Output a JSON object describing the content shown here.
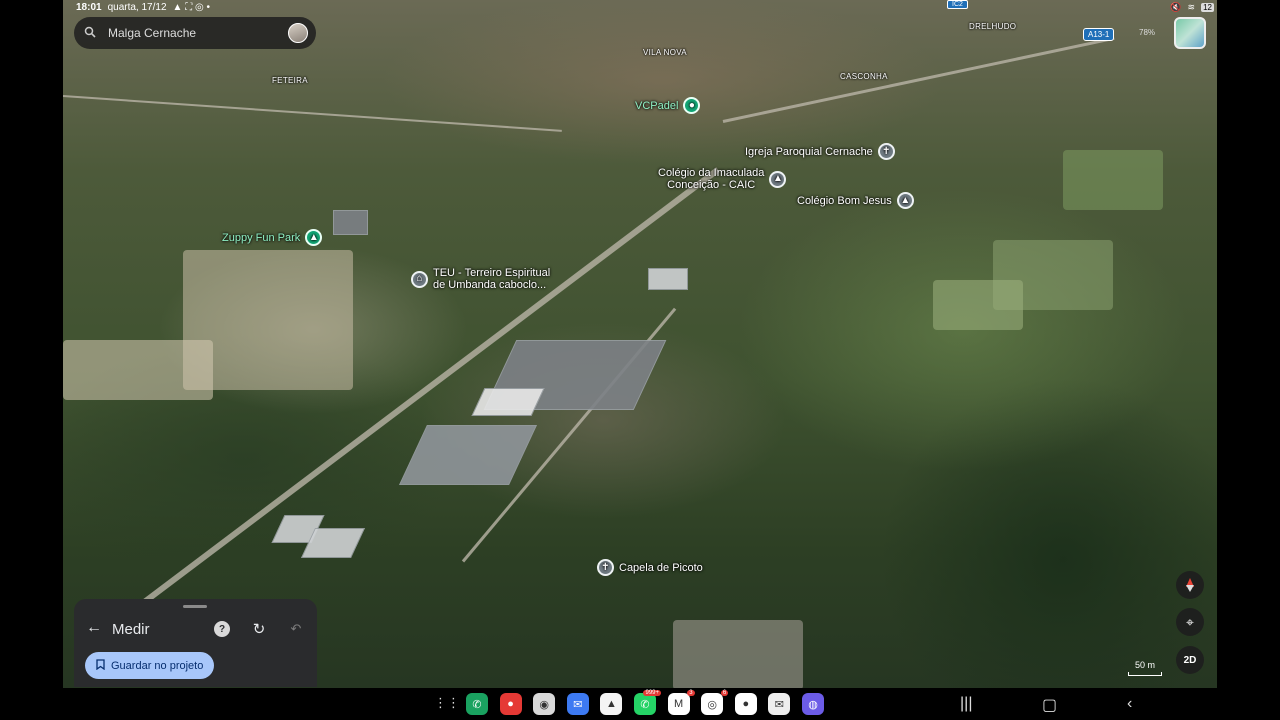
{
  "status_bar": {
    "time": "18:01",
    "date": "quarta, 17/12",
    "battery": "12",
    "volume_percent": "78%"
  },
  "search": {
    "value": "Malga Cernache"
  },
  "map": {
    "place_labels": [
      "FETEIRA",
      "VILA NOVA",
      "CASCONHA",
      "DRELHUDO"
    ],
    "road_shields": [
      "A13-1",
      "IC2"
    ],
    "pois": {
      "vcpadel": "VCPadel",
      "igreja": "Igreja Paroquial Cernache",
      "colegio_imaculada_1": "Colégio da Imaculada",
      "colegio_imaculada_2": "Conceição - CAIC",
      "colegio_bom_jesus": "Colégio Bom Jesus",
      "zuppy": "Zuppy Fun Park",
      "teu_1": "TEU - Terreiro Espiritual",
      "teu_2": "de Umbanda caboclo...",
      "capela": "Capela de Picoto"
    },
    "scale_label": "50 m",
    "view_toggle_label": "2D"
  },
  "measure_panel": {
    "title": "Medir",
    "save_label": "Guardar no projeto"
  },
  "nav_bar": {
    "apps": [
      {
        "name": "phone",
        "color": "#1aa260",
        "badge": ""
      },
      {
        "name": "contacts",
        "color": "#e53935",
        "badge": ""
      },
      {
        "name": "camera",
        "color": "#d9d9d9",
        "badge": ""
      },
      {
        "name": "messages",
        "color": "#3d7af2",
        "badge": ""
      },
      {
        "name": "drive",
        "color": "#f4f4f4",
        "badge": ""
      },
      {
        "name": "whatsapp",
        "color": "#25d366",
        "badge": "999+"
      },
      {
        "name": "gmail",
        "color": "#ffffff",
        "badge": "3"
      },
      {
        "name": "chrome",
        "color": "#ffffff",
        "badge": "6"
      },
      {
        "name": "account",
        "color": "#ffffff",
        "badge": ""
      },
      {
        "name": "mail",
        "color": "#eeeeee",
        "badge": ""
      },
      {
        "name": "browser",
        "color": "#6c5ce7",
        "badge": ""
      }
    ]
  }
}
